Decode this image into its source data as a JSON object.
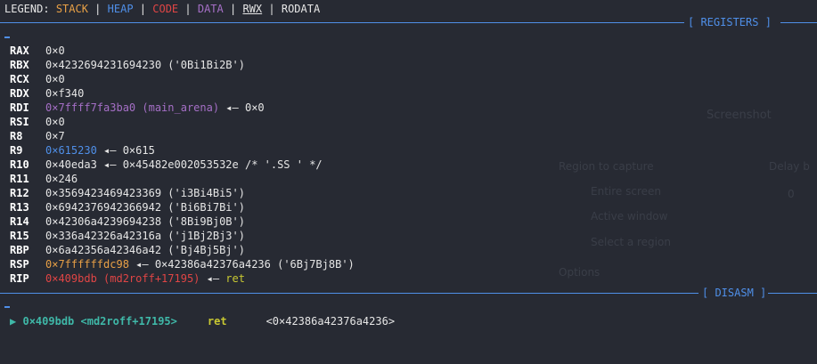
{
  "legend": {
    "label": "LEGEND:",
    "stack": "STACK",
    "heap": "HEAP",
    "code": "CODE",
    "data": "DATA",
    "rwx": "RWX",
    "rodata": "RODATA",
    "separator": "|"
  },
  "sections": {
    "registers": "[ REGISTERS ]",
    "disasm": "[ DISASM ]"
  },
  "registers": [
    {
      "name": "RAX",
      "value": "0×0",
      "kind": "plain",
      "rest": ""
    },
    {
      "name": "RBX",
      "value": "0×4232694231694230 ('0Bi1Bi2B')",
      "kind": "plain",
      "rest": ""
    },
    {
      "name": "RCX",
      "value": "0×0",
      "kind": "plain",
      "rest": ""
    },
    {
      "name": "RDX",
      "value": "0×f340",
      "kind": "plain",
      "rest": ""
    },
    {
      "name": "RDI",
      "value": "0×7ffff7fa3ba0 (main_arena)",
      "kind": "data",
      "rest": " ◂— 0×0"
    },
    {
      "name": "RSI",
      "value": "0×0",
      "kind": "plain",
      "rest": ""
    },
    {
      "name": "R8",
      "value": "0×7",
      "kind": "plain",
      "rest": ""
    },
    {
      "name": "R9",
      "value": "0×615230",
      "kind": "heap",
      "rest": " ◂— 0×615"
    },
    {
      "name": "R10",
      "value": "0×40eda3",
      "kind": "plain",
      "rest": " ◂— 0×45482e002053532e /* '.SS ' */"
    },
    {
      "name": "R11",
      "value": "0×246",
      "kind": "plain",
      "rest": ""
    },
    {
      "name": "R12",
      "value": "0×3569423469423369 ('i3Bi4Bi5')",
      "kind": "plain",
      "rest": ""
    },
    {
      "name": "R13",
      "value": "0×6942376942366942 ('Bi6Bi7Bi')",
      "kind": "plain",
      "rest": ""
    },
    {
      "name": "R14",
      "value": "0×42306a4239694238 ('8Bi9Bj0B')",
      "kind": "plain",
      "rest": ""
    },
    {
      "name": "R15",
      "value": "0×336a42326a42316a ('j1Bj2Bj3')",
      "kind": "plain",
      "rest": ""
    },
    {
      "name": "RBP",
      "value": "0×6a42356a42346a42 ('Bj4Bj5Bj')",
      "kind": "plain",
      "rest": ""
    },
    {
      "name": "RSP",
      "value": "0×7ffffffdc98",
      "kind": "stack",
      "rest": " ◂— 0×42386a42376a4236 ('6Bj7Bj8B')"
    },
    {
      "name": "RIP",
      "value": "0×409bdb (md2roff+17195)",
      "kind": "code",
      "rest": " ◂— ",
      "rest_tail": "ret"
    }
  ],
  "disasm": {
    "arrow": "▶",
    "address": "0×409bdb",
    "symbol": "<md2roff+17195>",
    "mnemonic": "ret",
    "operand": "<0×42386a42376a4236>"
  },
  "background": {
    "title": "Screenshot",
    "region": "Region to capture",
    "delay": "Delay b",
    "entire": "Entire screen",
    "active": "Active window",
    "select": "Select a region",
    "options": "Options",
    "delay_val": "0"
  },
  "colors": {
    "background": "#272a33",
    "stack": "#e8a046",
    "heap": "#4f8fe8",
    "code": "#e04545",
    "data": "#a56fc6",
    "separator": "#4f8fe8",
    "disasm": "#3fb8a8",
    "ret": "#c8c832"
  }
}
